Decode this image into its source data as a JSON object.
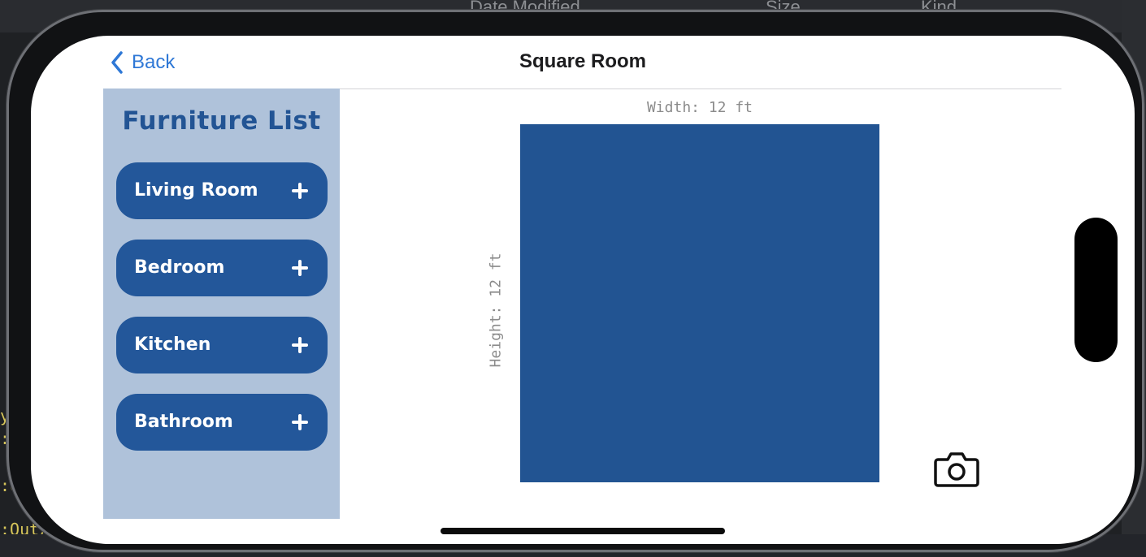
{
  "backdrop": {
    "column_header_date": "Date Modified",
    "column_header_size": "Size",
    "column_header_kind": "Kind",
    "code_line_1": "ySe",
    "code_line_2": ":Ou",
    "code_line_3": ":O",
    "code_line_4": ":Out/"
  },
  "nav": {
    "back_label": "Back",
    "title": "Square Room"
  },
  "sidebar": {
    "title": "Furniture List",
    "items": [
      {
        "label": "Living Room"
      },
      {
        "label": "Bedroom"
      },
      {
        "label": "Kitchen"
      },
      {
        "label": "Bathroom"
      }
    ]
  },
  "room": {
    "width_label": "Width: 12 ft",
    "height_label": "Height: 12 ft",
    "fill_color": "#225492"
  },
  "icons": {
    "back": "chevron-left-icon",
    "add": "plus-icon",
    "camera": "camera-icon"
  },
  "colors": {
    "accent": "#2f78d6",
    "sidebar_bg": "#afc2da",
    "button_bg": "#23579a"
  }
}
